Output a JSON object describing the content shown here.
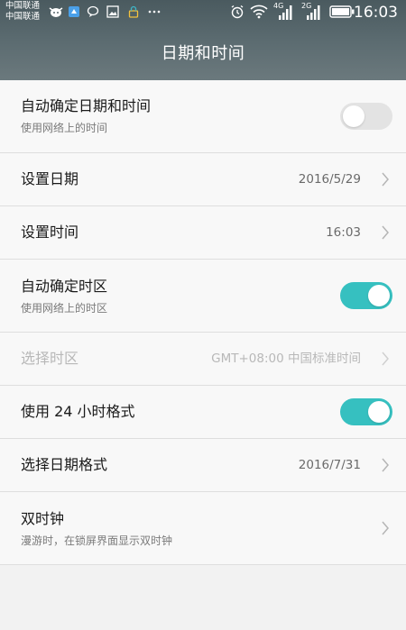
{
  "status_bar": {
    "carrier_1": "中国联通",
    "carrier_2": "中国联通",
    "network_1": "4G",
    "network_2": "2G",
    "time": "16:03"
  },
  "header": {
    "title": "日期和时间"
  },
  "settings": [
    {
      "label": "自动确定日期和时间",
      "sub": "使用网络上的时间",
      "toggle": "off"
    },
    {
      "label": "设置日期",
      "value": "2016/5/29"
    },
    {
      "label": "设置时间",
      "value": "16:03"
    },
    {
      "label": "自动确定时区",
      "sub": "使用网络上的时区",
      "toggle": "on"
    },
    {
      "label": "选择时区",
      "value": "GMT+08:00 中国标准时间",
      "disabled": true
    },
    {
      "label": "使用 24 小时格式",
      "toggle": "on"
    },
    {
      "label": "选择日期格式",
      "value": "2016/7/31"
    },
    {
      "label": "双时钟",
      "sub": "漫游时，在锁屏界面显示双时钟"
    }
  ],
  "colors": {
    "accent": "#36c0c0",
    "toggle_off": "#e3e3e3",
    "header": "#5b6b70"
  }
}
